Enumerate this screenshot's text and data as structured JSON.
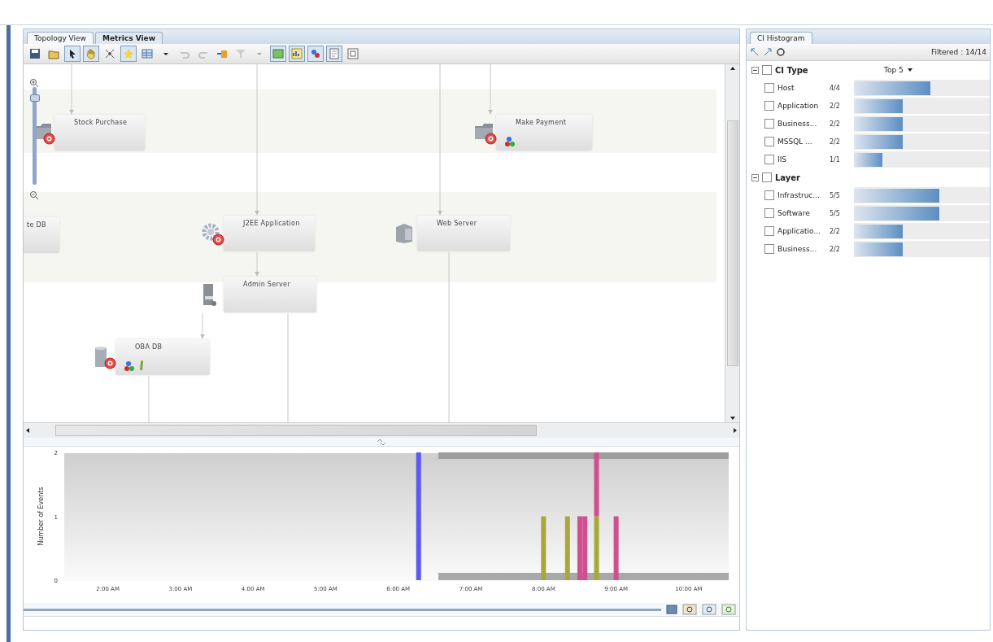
{
  "tabs": [
    {
      "label": "Topology View",
      "selected": true
    },
    {
      "label": "Metrics View",
      "selected": false
    }
  ],
  "toolbar": [
    {
      "kind": "save",
      "selected": false,
      "disabled": false
    },
    {
      "kind": "open",
      "selected": false,
      "disabled": false
    },
    {
      "kind": "pointer",
      "selected": true,
      "disabled": false
    },
    {
      "kind": "hand",
      "selected": true,
      "disabled": false
    },
    {
      "kind": "fit",
      "selected": false,
      "disabled": false
    },
    {
      "kind": "star",
      "selected": true,
      "disabled": false
    },
    {
      "kind": "grid",
      "selected": false,
      "disabled": false
    },
    {
      "kind": "caret",
      "selected": false,
      "disabled": false
    },
    {
      "kind": "undo",
      "selected": false,
      "disabled": true
    },
    {
      "kind": "redo",
      "selected": false,
      "disabled": true
    },
    {
      "kind": "export",
      "selected": false,
      "disabled": false
    },
    {
      "kind": "filter",
      "selected": false,
      "disabled": true
    },
    {
      "kind": "caret",
      "selected": false,
      "disabled": true
    },
    {
      "kind": "map",
      "selected": true,
      "disabled": false
    },
    {
      "kind": "chart",
      "selected": true,
      "disabled": false
    },
    {
      "kind": "users",
      "selected": true,
      "disabled": false
    },
    {
      "kind": "note",
      "selected": true,
      "disabled": false
    },
    {
      "kind": "frame",
      "selected": false,
      "disabled": false
    }
  ],
  "zoom_slider": {
    "level": 0.92
  },
  "nodes": [
    {
      "label": "Stock Purchase",
      "kind": "business",
      "critical": true,
      "users": false,
      "edit": false
    },
    {
      "label": "Make Payment",
      "kind": "business",
      "critical": true,
      "users": true,
      "edit": false
    },
    {
      "label": "te DB",
      "kind": "cut",
      "critical": false,
      "users": false,
      "edit": false
    },
    {
      "label": "J2EE Application",
      "kind": "application",
      "critical": true,
      "users": false,
      "edit": false
    },
    {
      "label": "Web Server",
      "kind": "web",
      "critical": false,
      "users": false,
      "edit": false
    },
    {
      "label": "Admin Server",
      "kind": "server",
      "critical": false,
      "users": false,
      "edit": false
    },
    {
      "label": "OBA DB",
      "kind": "database",
      "critical": true,
      "users": true,
      "edit": true
    }
  ],
  "chart_data": {
    "type": "bar",
    "ylabel": "Number of Events",
    "stacked": true,
    "x": [
      6.28,
      8.0,
      8.33,
      8.5,
      8.57,
      8.73,
      9.0
    ],
    "xlim": [
      1.4,
      10.55
    ],
    "ylim": [
      0,
      2
    ],
    "xticks": [
      {
        "value": 2,
        "label": "2:00 AM"
      },
      {
        "value": 3,
        "label": "3:00 AM"
      },
      {
        "value": 4,
        "label": "4:00 AM"
      },
      {
        "value": 5,
        "label": "5:00 AM"
      },
      {
        "value": 6,
        "label": "6:00 AM"
      },
      {
        "value": 7,
        "label": "7:00 AM"
      },
      {
        "value": 8,
        "label": "8:00 AM"
      },
      {
        "value": 9,
        "label": "9:00 AM"
      },
      {
        "value": 10,
        "label": "10:00 AM"
      }
    ],
    "yticks": [
      0,
      1,
      2
    ],
    "series": [
      {
        "color": "#5b5bf0",
        "values": [
          2,
          null,
          null,
          null,
          null,
          null,
          null
        ]
      },
      {
        "color": "#a8a83a",
        "values": [
          null,
          1,
          1,
          null,
          null,
          1,
          null
        ]
      },
      {
        "color": "#d0508f",
        "values": [
          null,
          null,
          null,
          1,
          1,
          1,
          1
        ]
      }
    ]
  },
  "histogram": {
    "tab": "CI Histogram",
    "filtered": "Filtered : 14/14",
    "groups": [
      {
        "title": "CI Type",
        "expanded": true,
        "checked": false,
        "top": "Top 5",
        "items": [
          {
            "label": "Host",
            "count": "4/4",
            "checked": false,
            "level": 0.56
          },
          {
            "label": "Application",
            "count": "2/2",
            "checked": false,
            "level": 0.36
          },
          {
            "label": "Business...",
            "count": "2/2",
            "checked": false,
            "level": 0.36
          },
          {
            "label": "MSSQL ...",
            "count": "2/2",
            "checked": false,
            "level": 0.36
          },
          {
            "label": "IIS",
            "count": "1/1",
            "checked": false,
            "level": 0.21
          }
        ]
      },
      {
        "title": "Layer",
        "expanded": true,
        "checked": false,
        "items": [
          {
            "label": "Infrastruc...",
            "count": "5/5",
            "checked": false,
            "level": 0.63
          },
          {
            "label": "Software",
            "count": "5/5",
            "checked": false,
            "level": 0.63
          },
          {
            "label": "Applicatio...",
            "count": "2/2",
            "checked": false,
            "level": 0.36
          },
          {
            "label": "Business...",
            "count": "2/2",
            "checked": false,
            "level": 0.36
          }
        ]
      }
    ]
  }
}
